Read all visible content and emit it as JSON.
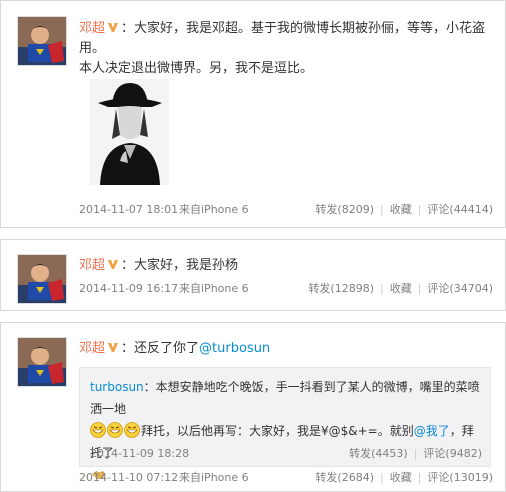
{
  "posts": [
    {
      "author": "邓超",
      "text_line1": "：大家好，我是邓超。基于我的微博长期被孙俪，等等，小花盗用。",
      "text_line2": "本人决定退出微博界。另，我不是逗比。",
      "time": "2014-11-07 18:01",
      "source": "来自iPhone 6",
      "repost": "转发(8209)",
      "favorite": "收藏",
      "comment": "评论(44414)"
    },
    {
      "author": "邓超",
      "text": "：大家好，我是孙杨",
      "time": "2014-11-09 16:17",
      "source": "来自iPhone 6",
      "repost": "转发(12898)",
      "favorite": "收藏",
      "comment": "评论(34704)"
    },
    {
      "author": "邓超",
      "text_prefix": "：还反了你了",
      "mention": "@turbosun",
      "time": "2014-11-10 07:12",
      "source": "来自iPhone 6",
      "repost": "转发(2684)",
      "favorite": "收藏",
      "comment": "评论(13019)",
      "quote": {
        "author": "turbosun",
        "line1": "：本想安静地吃个晚饭，手一抖看到了某人的微博，嘴里的菜喷洒一地",
        "line2_text": "拜托，以后他再写：大家好，我是¥@$&+=。就别",
        "line2_mention": "@我了",
        "line2_tail": "，拜托了",
        "time": "2014-11-09 18:28",
        "repost": "转发(4453)",
        "comment": "评论(9482)"
      }
    }
  ],
  "colors": {
    "author": "#eb7350",
    "link": "#0a8cd2",
    "meta": "#808080"
  }
}
